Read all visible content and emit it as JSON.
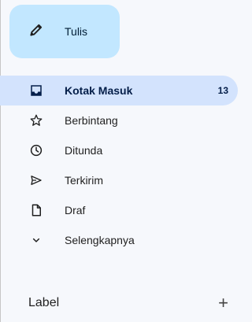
{
  "compose": {
    "label": "Tulis",
    "icon": "pencil-icon"
  },
  "nav": {
    "items": [
      {
        "label": "Kotak Masuk",
        "icon": "inbox-icon",
        "count": "13",
        "active": true
      },
      {
        "label": "Berbintang",
        "icon": "star-icon"
      },
      {
        "label": "Ditunda",
        "icon": "clock-icon"
      },
      {
        "label": "Terkirim",
        "icon": "send-icon"
      },
      {
        "label": "Draf",
        "icon": "draft-icon"
      },
      {
        "label": "Selengkapnya",
        "icon": "chevron-down-icon"
      }
    ]
  },
  "labels": {
    "title": "Label",
    "add_icon": "plus-icon",
    "add_symbol": "+"
  },
  "colors": {
    "compose_bg": "#c2e7ff",
    "active_bg": "#d3e3fd",
    "background": "#f6f8fc"
  }
}
